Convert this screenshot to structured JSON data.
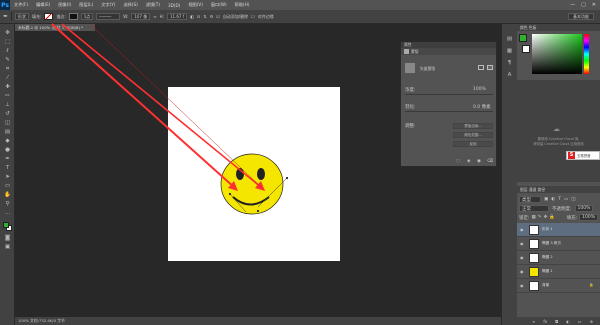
{
  "menubar": {
    "logo": "Ps",
    "items": [
      "文件(F)",
      "编辑(E)",
      "图像(I)",
      "图层(L)",
      "文字(Y)",
      "选择(S)",
      "滤镜(T)",
      "3D(D)",
      "视图(V)",
      "窗口(W)",
      "帮助(H)"
    ],
    "window_controls": [
      "—",
      "▢",
      "✕"
    ]
  },
  "options_bar": {
    "tool_mode": "形状",
    "fill_label": "填充:",
    "stroke_label": "描边:",
    "stroke_size": "1点",
    "width_label": "W:",
    "width_value": "107 像",
    "height_label": "H:",
    "height_value": "11.67 f",
    "auto_add_delete": "自动添加/删除",
    "align_edges": "对齐边缘",
    "workspace": "基本功能"
  },
  "document": {
    "tab_title": "未标题-1 @ 100% (形状 1, RGB/8) *",
    "status": "100%   文档:732.4K/0 字节"
  },
  "properties_panel": {
    "title": "属性",
    "tab": "蒙版",
    "mask_label": "矢量蒙版",
    "density_label": "浓度:",
    "density_value": "100%",
    "feather_label": "羽化:",
    "feather_value": "0.0 像素",
    "adjust_label": "调整:",
    "buttons": [
      "蒙版边缘...",
      "颜色范围...",
      "反相"
    ]
  },
  "color_panel": {
    "tabs": "颜色   色板"
  },
  "library_panel": {
    "message_line1": "要使用 Creative Cloud 库,",
    "message_line2": "请安装 Creative Cloud 应用程序"
  },
  "ime_bar": {
    "label": "S",
    "text": "五笔拼音"
  },
  "layers_panel": {
    "tabs": "图层  通道  路径",
    "kind_label": "类型",
    "blend_mode": "正常",
    "opacity_label": "不透明度:",
    "opacity_value": "100%",
    "lock_label": "锁定:",
    "fill_label": "填充:",
    "fill_value": "100%",
    "layers": [
      {
        "name": "形状 1",
        "selected": true,
        "thumb": "#ffffff"
      },
      {
        "name": "椭圆 3 拷贝",
        "selected": false,
        "thumb": "#ffffff"
      },
      {
        "name": "椭圆 2",
        "selected": false,
        "thumb": "#ffffff"
      },
      {
        "name": "椭圆 1",
        "selected": false,
        "thumb": "#f5e600"
      },
      {
        "name": "背景",
        "selected": false,
        "thumb": "#ffffff"
      }
    ],
    "bottom_icons": [
      "fx-icon",
      "mask-icon",
      "adjust-icon",
      "folder-icon",
      "new-layer-icon",
      "trash-icon"
    ]
  },
  "colors": {
    "smiley_fill": "#f5e600",
    "arrow": "#ff3030",
    "accent": "#31a8ff"
  }
}
